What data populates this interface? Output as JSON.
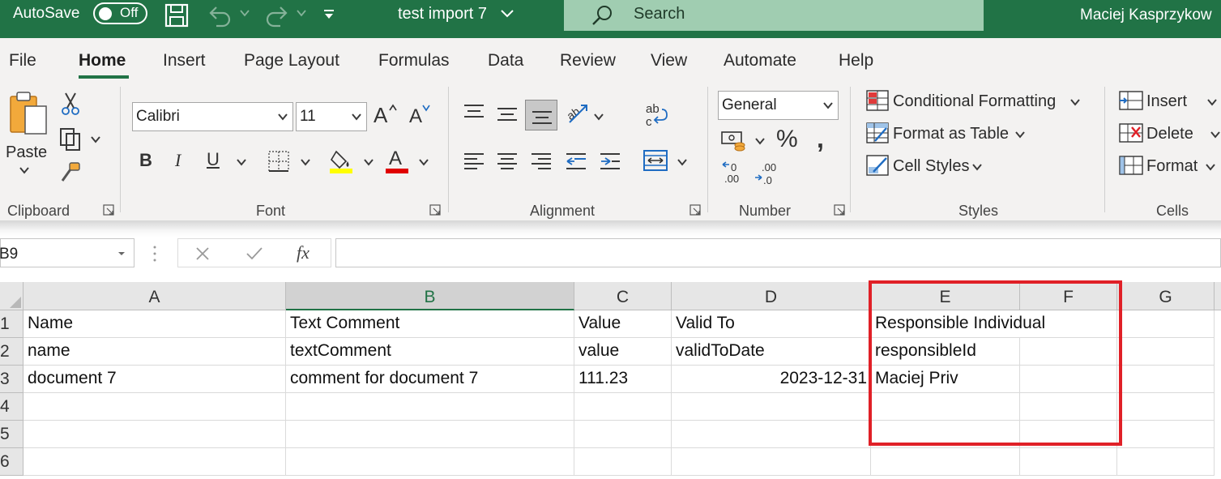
{
  "titlebar": {
    "autosave_label": "AutoSave",
    "autosave_state": "Off",
    "doc_title": "test import 7",
    "search_label": "Search",
    "user_name": "Maciej Kasprzykow",
    "bg_color": "#217346"
  },
  "tabs": [
    {
      "label": "File"
    },
    {
      "label": "Home",
      "active": true
    },
    {
      "label": "Insert"
    },
    {
      "label": "Page Layout"
    },
    {
      "label": "Formulas"
    },
    {
      "label": "Data"
    },
    {
      "label": "Review"
    },
    {
      "label": "View"
    },
    {
      "label": "Automate"
    },
    {
      "label": "Help"
    }
  ],
  "ribbon": {
    "clipboard": {
      "paste_label": "Paste",
      "group_label": "Clipboard"
    },
    "font": {
      "font_name": "Calibri",
      "font_size": "11",
      "group_label": "Font"
    },
    "alignment": {
      "group_label": "Alignment"
    },
    "number": {
      "format": "General",
      "group_label": "Number"
    },
    "styles": {
      "conditional_formatting": "Conditional Formatting",
      "format_as_table": "Format as Table",
      "cell_styles": "Cell Styles",
      "group_label": "Styles"
    },
    "cells": {
      "insert": "Insert",
      "delete": "Delete",
      "format": "Format",
      "group_label": "Cells"
    }
  },
  "formula_bar": {
    "name_box": "B9",
    "formula": ""
  },
  "grid": {
    "columns": [
      "A",
      "B",
      "C",
      "D",
      "E",
      "F",
      "G"
    ],
    "selected_column": "B",
    "rows": [
      "1",
      "2",
      "3",
      "4",
      "5",
      "6"
    ],
    "cells": {
      "A1": "Name",
      "B1": "Text Comment",
      "C1": "Value",
      "D1": "Valid To",
      "E1": "Responsible Individual",
      "A2": "name",
      "B2": "textComment",
      "C2": "value",
      "D2": "validToDate",
      "E2": "responsibleId",
      "A3": "document 7",
      "B3": "comment for document 7",
      "C3": "111.23",
      "D3": "2023-12-31",
      "E3": "Maciej Priv"
    },
    "highlight_color": "#e02027"
  }
}
